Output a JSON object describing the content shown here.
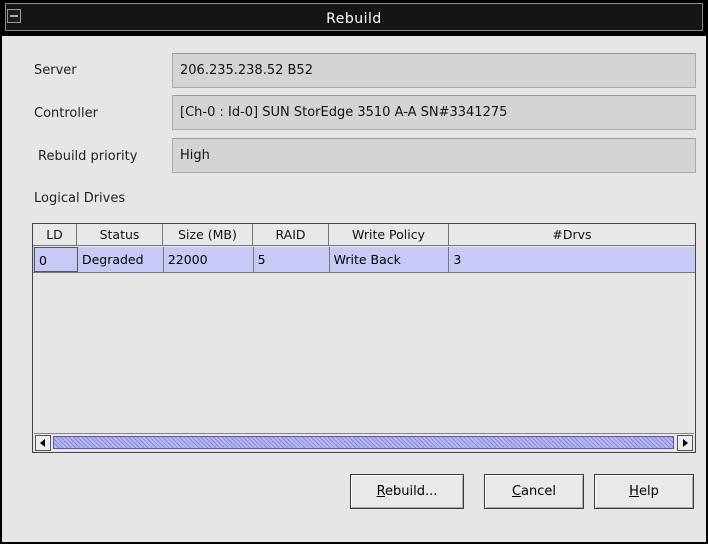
{
  "window": {
    "title": "Rebuild"
  },
  "form": {
    "server_label": "Server",
    "server_value": "206.235.238.52 B52",
    "controller_label": "Controller",
    "controller_value": "[Ch-0 : Id-0] SUN StorEdge 3510 A-A SN#3341275",
    "priority_label": "Rebuild priority",
    "priority_value": "High"
  },
  "logical_drives": {
    "label": "Logical Drives",
    "columns": [
      "LD",
      "Status",
      "Size (MB)",
      "RAID",
      "Write Policy",
      "#Drvs"
    ],
    "rows": [
      [
        "0",
        "Degraded",
        "22000",
        "5",
        "Write Back",
        "3"
      ]
    ]
  },
  "buttons": {
    "rebuild": {
      "mnemonic": "R",
      "rest": "ebuild..."
    },
    "cancel": {
      "mnemonic": "C",
      "rest": "ancel"
    },
    "help": {
      "mnemonic": "H",
      "rest": "elp"
    }
  },
  "colors": {
    "selected_row": "#c9c9f5",
    "scroll_thumb": "#9a9ae0",
    "titlebar": "#151515"
  }
}
